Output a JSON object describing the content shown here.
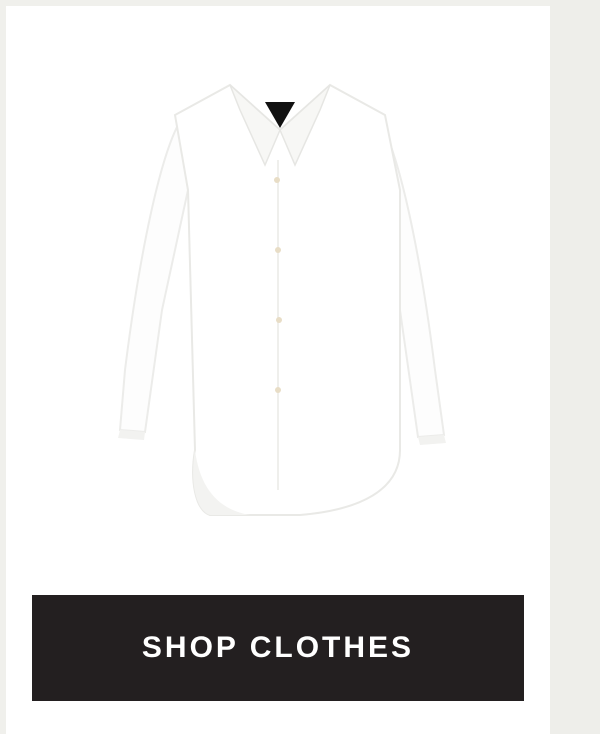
{
  "product": {
    "image_icon": "white-button-up-shirt",
    "colors": {
      "shirt": "#ffffff",
      "shadow": "#e9e9e6",
      "button": "#e8ddc6",
      "tag": "#111111"
    }
  },
  "cta": {
    "label": "SHOP CLOTHES",
    "background": "#231f20",
    "text_color": "#ffffff"
  },
  "page": {
    "background": "#efefeb",
    "card_background": "#ffffff"
  }
}
